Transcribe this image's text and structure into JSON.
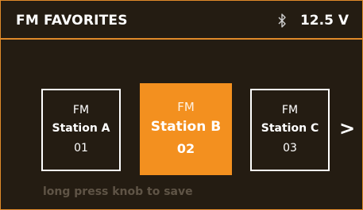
{
  "header": {
    "title": "FM FAVORITES",
    "bluetooth_icon": "bluetooth-icon",
    "voltage": "12.5 V"
  },
  "stations": [
    {
      "band": "FM",
      "name": "Station A",
      "number": "01",
      "selected": false
    },
    {
      "band": "FM",
      "name": "Station B",
      "number": "02",
      "selected": true
    },
    {
      "band": "FM",
      "name": "Station C",
      "number": "03",
      "selected": false
    }
  ],
  "nav": {
    "next_label": ">"
  },
  "hint": "long press knob to save",
  "colors": {
    "accent": "#f3901f",
    "background": "#241c12",
    "border": "#e08a2a",
    "hint_text": "#5f5446"
  }
}
